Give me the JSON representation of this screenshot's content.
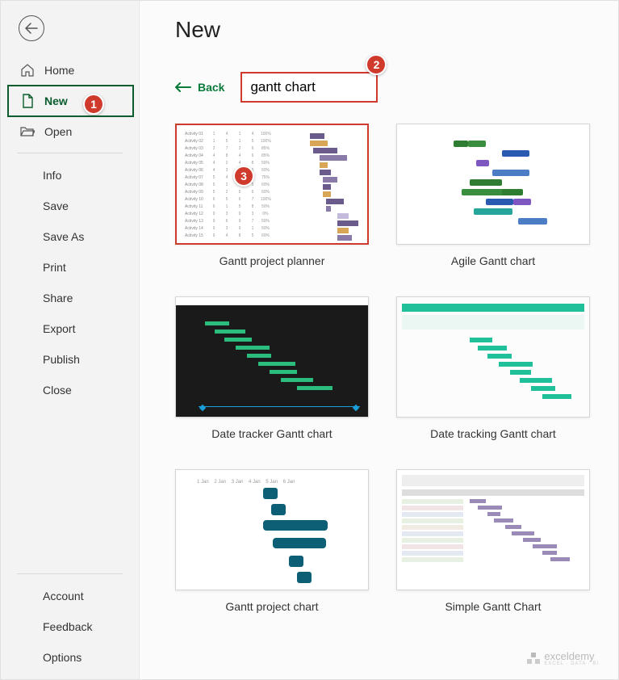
{
  "colors": {
    "accent": "#0a7a3a",
    "callout": "#d03a2c"
  },
  "sidebar": {
    "home": "Home",
    "new": "New",
    "open": "Open",
    "items": [
      {
        "label": "Info"
      },
      {
        "label": "Save"
      },
      {
        "label": "Save As"
      },
      {
        "label": "Print"
      },
      {
        "label": "Share"
      },
      {
        "label": "Export"
      },
      {
        "label": "Publish"
      },
      {
        "label": "Close"
      }
    ],
    "bottom": [
      {
        "label": "Account"
      },
      {
        "label": "Feedback"
      },
      {
        "label": "Options"
      }
    ]
  },
  "main": {
    "title": "New",
    "back_label": "Back",
    "search_value": "gantt chart"
  },
  "callouts": {
    "one": "1",
    "two": "2",
    "three": "3"
  },
  "templates": [
    {
      "name": "Gantt project planner"
    },
    {
      "name": "Agile Gantt chart"
    },
    {
      "name": "Date tracker Gantt chart"
    },
    {
      "name": "Date tracking Gantt chart"
    },
    {
      "name": "Gantt project chart"
    },
    {
      "name": "Simple Gantt Chart"
    }
  ],
  "watermark": {
    "brand": "exceldemy",
    "tagline": "EXCEL · DATA · BI"
  }
}
